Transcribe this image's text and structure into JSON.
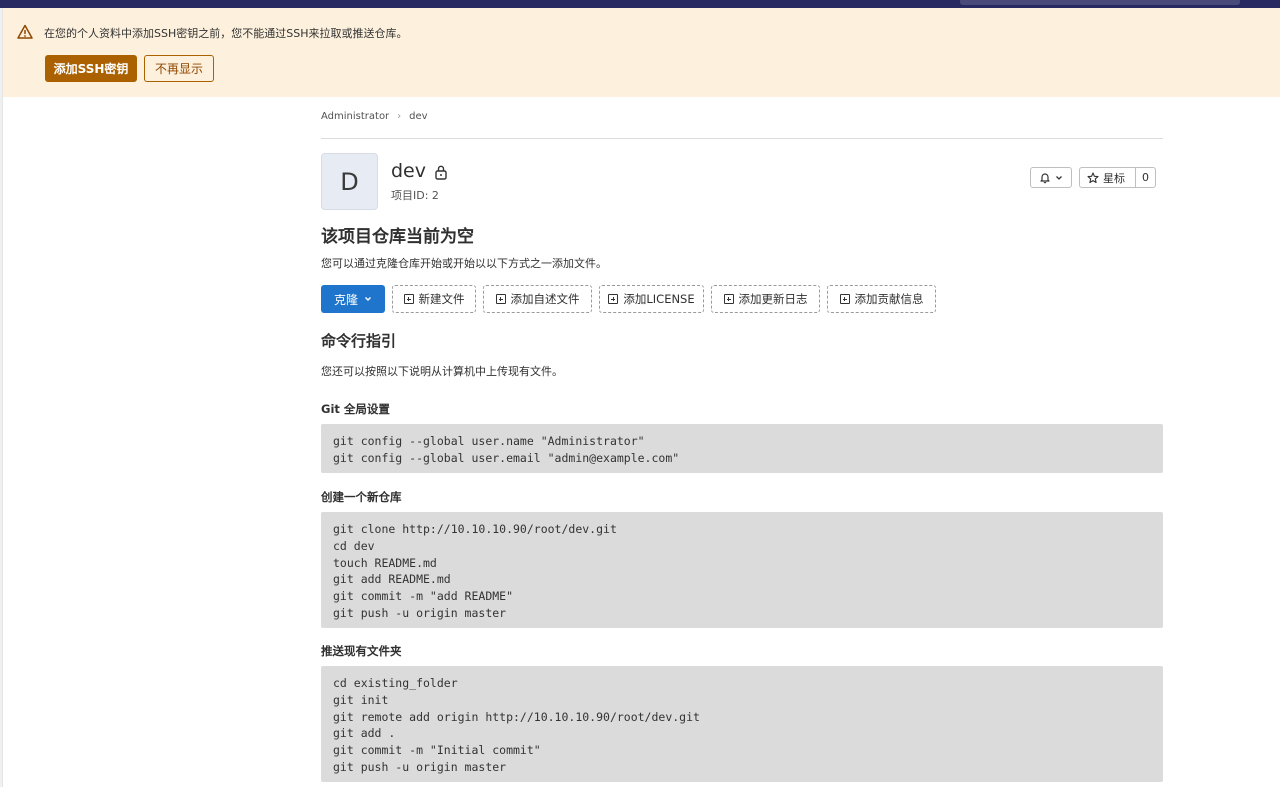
{
  "alert": {
    "text": "在您的个人资料中添加SSH密钥之前，您不能通过SSH来拉取或推送仓库。",
    "add_ssh_key_label": "添加SSH密钥",
    "dont_show_again_label": "不再显示"
  },
  "breadcrumb": {
    "items": [
      "Administrator",
      "dev"
    ]
  },
  "project": {
    "avatar_letter": "D",
    "name": "dev",
    "id_label": "项目ID: 2",
    "star_label": "星标",
    "star_count": "0"
  },
  "empty_repo": {
    "title": "该项目仓库当前为空",
    "description": "您可以通过克隆仓库开始或开始以以下方式之一添加文件。",
    "clone_label": "克隆",
    "actions": [
      "新建文件",
      "添加自述文件",
      "添加LICENSE",
      "添加更新日志",
      "添加贡献信息"
    ]
  },
  "cli": {
    "title": "命令行指引",
    "description": "您还可以按照以下说明从计算机中上传现有文件。",
    "sections": [
      {
        "title": "Git 全局设置",
        "code": "git config --global user.name \"Administrator\"\ngit config --global user.email \"admin@example.com\""
      },
      {
        "title": "创建一个新仓库",
        "code": "git clone http://10.10.10.90/root/dev.git\ncd dev\ntouch README.md\ngit add README.md\ngit commit -m \"add README\"\ngit push -u origin master"
      },
      {
        "title": "推送现有文件夹",
        "code": "cd existing_folder\ngit init\ngit remote add origin http://10.10.10.90/root/dev.git\ngit add .\ngit commit -m \"Initial commit\"\ngit push -u origin master"
      }
    ]
  },
  "colors": {
    "alert_bg": "#fdf1dd",
    "warning_button": "#ab6100",
    "primary_blue": "#1f75cb",
    "code_bg": "#dbdbdb",
    "topbar": "#292961"
  },
  "icons": {
    "alert": "warning-icon",
    "lock": "lock-icon",
    "notification": "bell-icon",
    "star": "star-icon",
    "add": "plus-square-icon",
    "dropdown": "chevron-down-icon"
  }
}
